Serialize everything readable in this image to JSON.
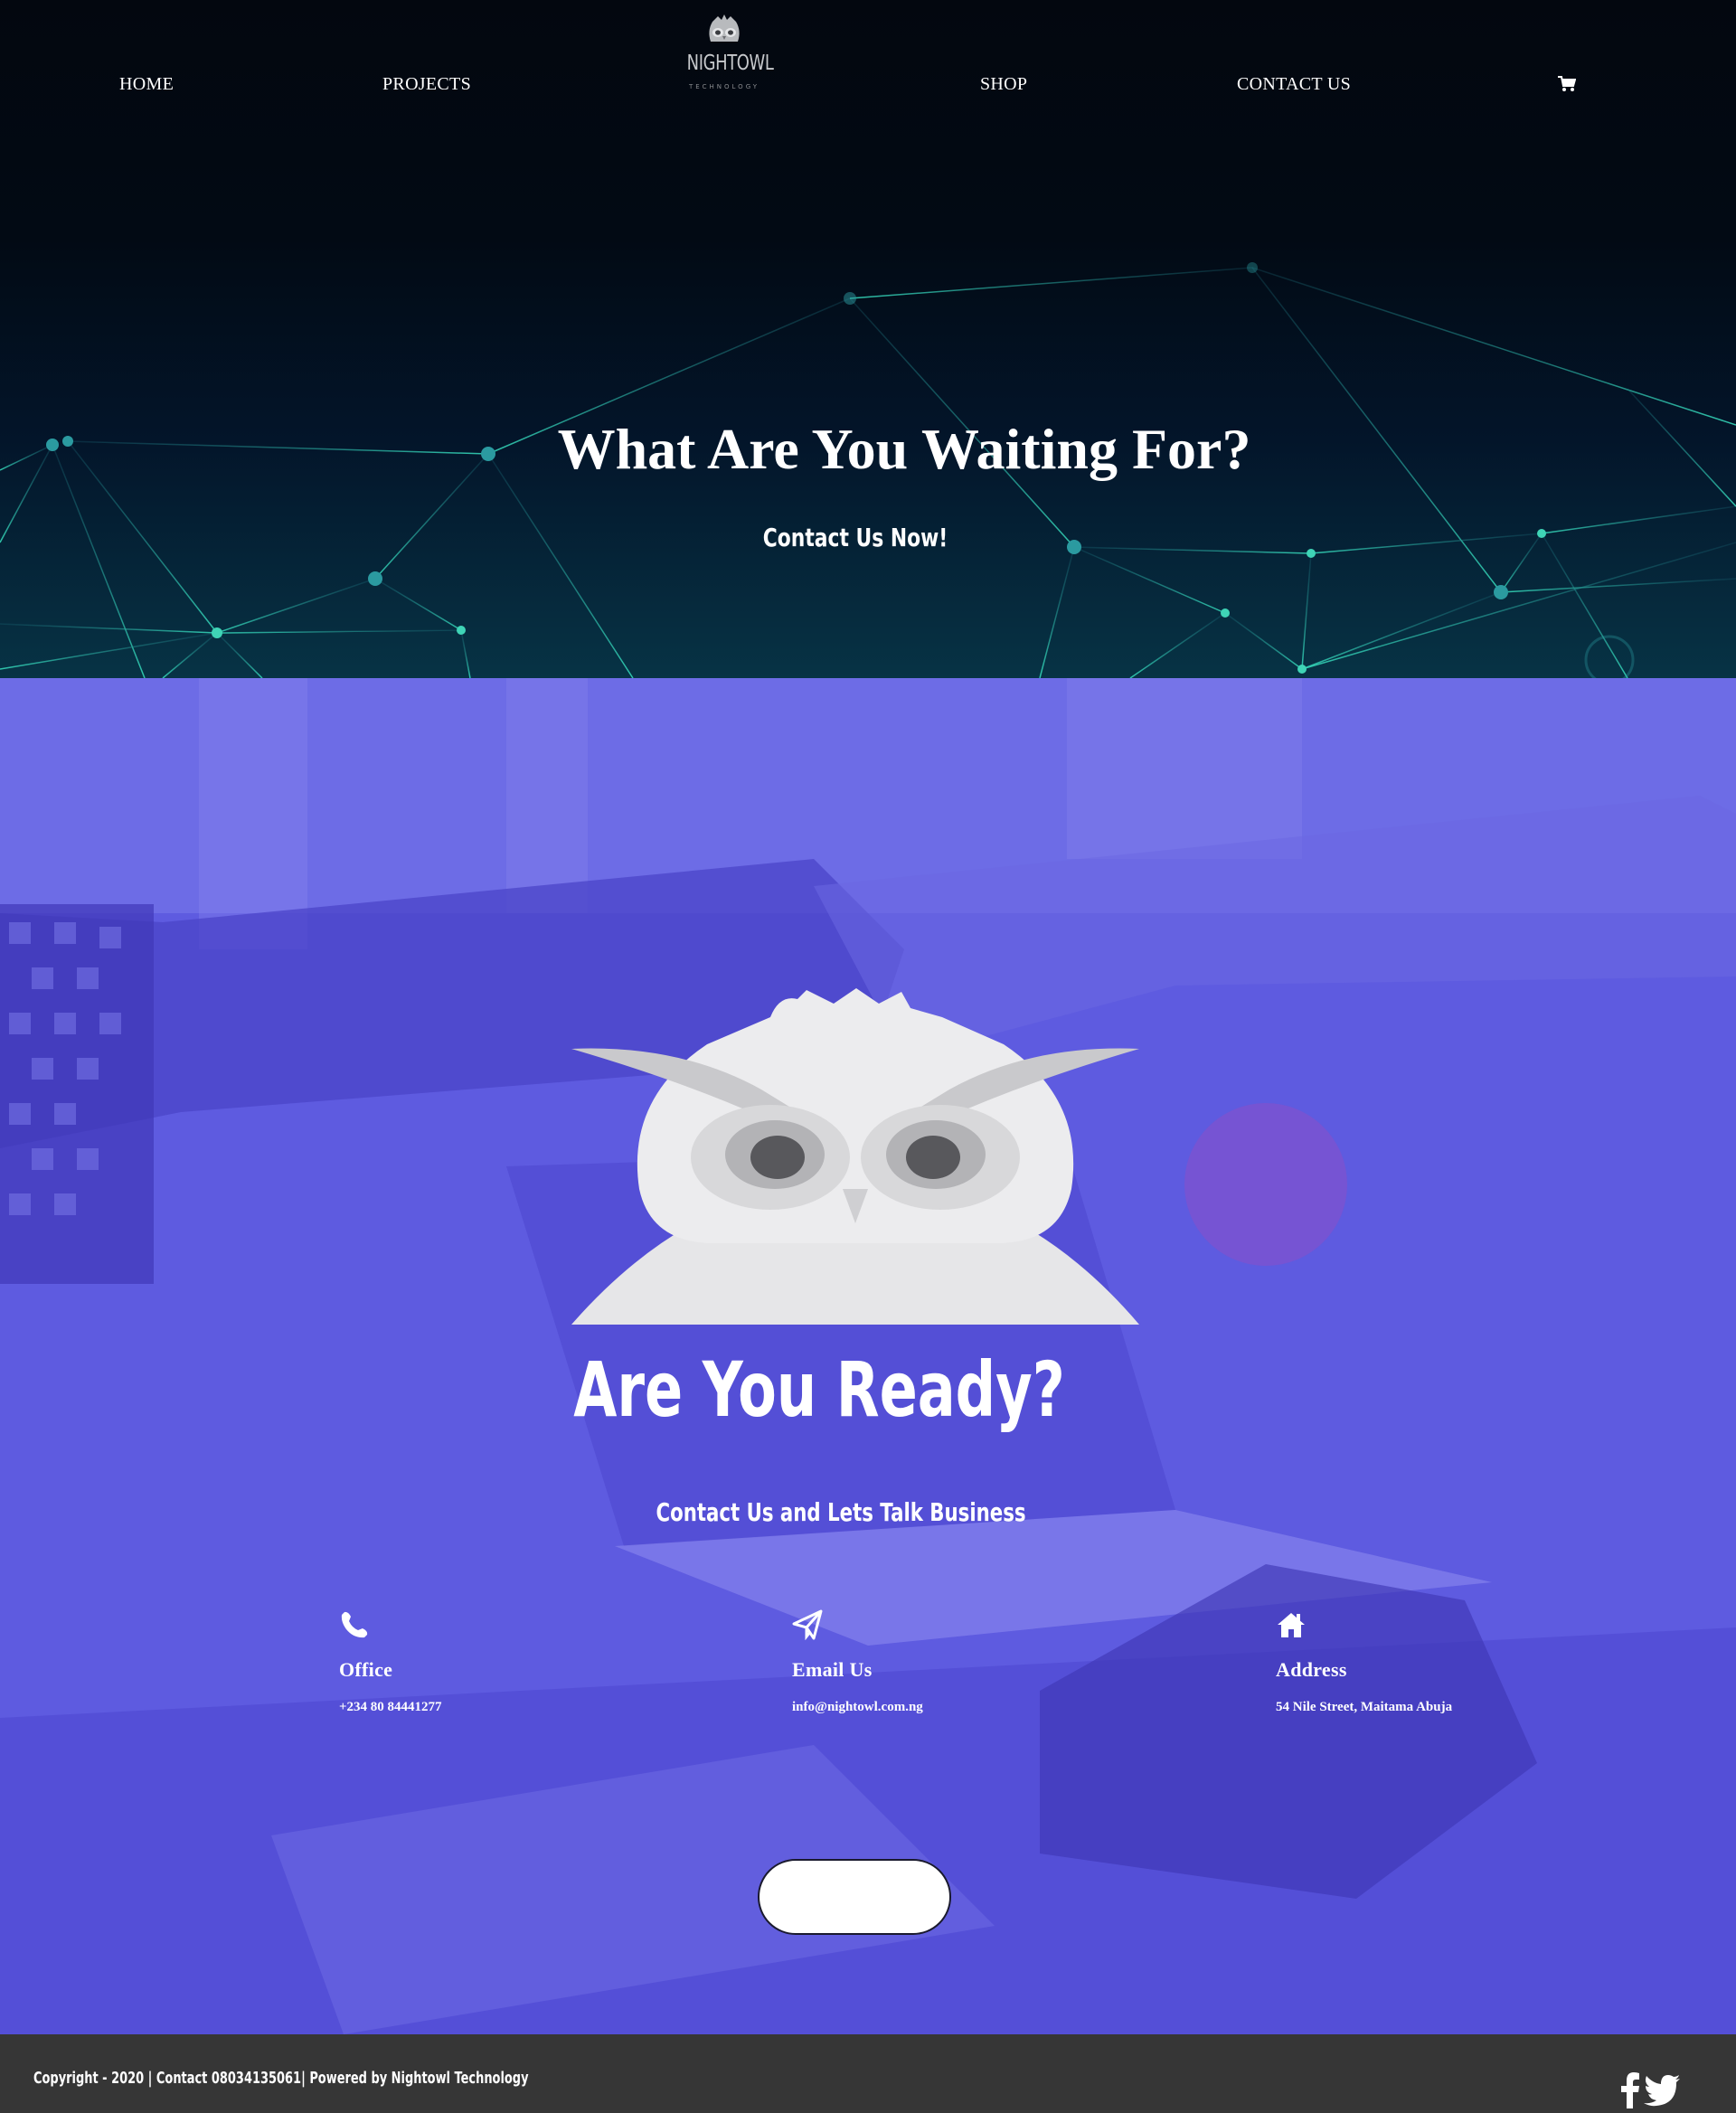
{
  "nav": {
    "items": [
      {
        "label": "HOME"
      },
      {
        "label": "PROJECTS"
      },
      {
        "label": "SHOP"
      },
      {
        "label": "CONTACT US"
      }
    ],
    "logo": {
      "word": "NIGHTOWL",
      "sub": "TECHNOLOGY"
    },
    "cart_icon": "shopping-cart-icon"
  },
  "hero": {
    "title": "What Are You Waiting For?",
    "subtitle": "Contact Us Now!"
  },
  "ready": {
    "title": "Are You Ready?",
    "subtitle": "Contact Us and Lets Talk Business",
    "info": [
      {
        "icon": "phone-icon",
        "title": "Office",
        "value": "+234 80 84441277"
      },
      {
        "icon": "paper-plane-icon",
        "title": "Email Us",
        "value": "info@nightowl.com.ng"
      },
      {
        "icon": "home-icon",
        "title": "Address",
        "value": "54 Nile Street, Maitama Abuja"
      }
    ],
    "button_label": ""
  },
  "footer": {
    "text": "Copyright - 2020 | Contact 08034135061| Powered by Nightowl Technology",
    "social": [
      "facebook-icon",
      "twitter-icon"
    ]
  },
  "colors": {
    "hero_dark": "#03070f",
    "hero_teal": "#2fd1b5",
    "ready_purple": "#5b57de",
    "footer": "#363636",
    "text": "#ffffff"
  }
}
